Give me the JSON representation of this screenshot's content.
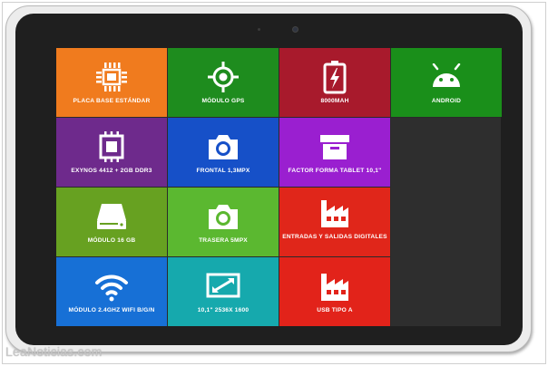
{
  "tiles": [
    {
      "label": "PLACA BASE ESTÁNDAR",
      "color": "#f07b1e",
      "icon": "motherboard-icon"
    },
    {
      "label": "MÓDULO GPS",
      "color": "#1e8c1e",
      "icon": "gps-crosshair-icon"
    },
    {
      "label": "8000MAH",
      "color": "#a81a2c",
      "icon": "battery-icon"
    },
    {
      "label": "ANDROID",
      "color": "#1a8f1a",
      "icon": "android-icon"
    },
    {
      "label": "EXYNOS 4412 + 2GB DDR3",
      "color": "#6e2a8c",
      "icon": "processor-chip-icon"
    },
    {
      "label": "FRONTAL 1,3MPX",
      "color": "#1650c8",
      "icon": "camera-icon"
    },
    {
      "label": "FACTOR FORMA TABLET 10,1\"",
      "color": "#9a1fd0",
      "icon": "box-icon"
    },
    {
      "label": "MÓDULO 16 GB",
      "color": "#67a121",
      "icon": "storage-drive-icon"
    },
    {
      "label": "TRASERA 5MPX",
      "color": "#5bb830",
      "icon": "camera-icon"
    },
    {
      "label": "ENTRADAS Y SALIDAS DIGITALES",
      "color": "#e0261a",
      "icon": "factory-icon"
    },
    {
      "label": "MÓDULO 2.4GHZ WIFI B/G/N",
      "color": "#1770d6",
      "icon": "wifi-icon"
    },
    {
      "label": "10,1\" 2536X 1600",
      "color": "#16a9ad",
      "icon": "screen-resize-icon"
    },
    {
      "label": "USB TIPO A",
      "color": "#e2231a",
      "icon": "factory-icon"
    }
  ],
  "watermark": "LeaNoticias.com"
}
